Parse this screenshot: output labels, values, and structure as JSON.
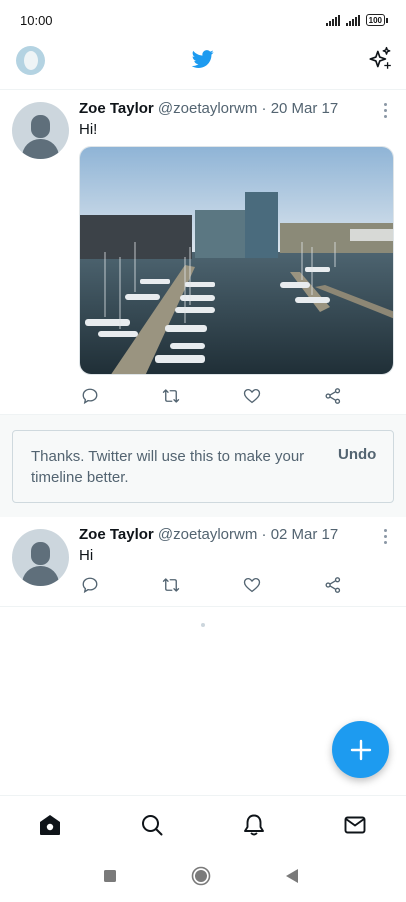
{
  "status_bar": {
    "time": "10:00",
    "battery": "100"
  },
  "app": {
    "brand_color": "#1d9bf0"
  },
  "tweets": [
    {
      "name": "Zoe Taylor",
      "handle": "@zoetaylorwm",
      "separator": "·",
      "date": "20 Mar 17",
      "text": "Hi!",
      "has_media": true
    },
    {
      "name": "Zoe Taylor",
      "handle": "@zoetaylorwm",
      "separator": "·",
      "date": "02 Mar 17",
      "text": "Hi",
      "has_media": false
    }
  ],
  "feedback": {
    "message": "Thanks. Twitter will use this to make your timeline better.",
    "undo_label": "Undo"
  },
  "bottom_nav": [
    "home-icon",
    "search-icon",
    "notifications-icon",
    "messages-icon"
  ],
  "system_nav": [
    "recent-apps-icon",
    "home-button-icon",
    "back-icon"
  ]
}
